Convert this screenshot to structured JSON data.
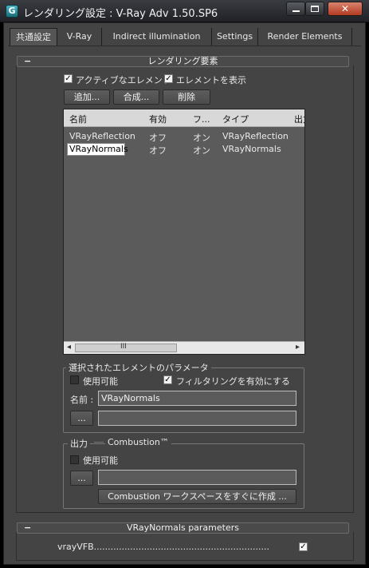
{
  "window": {
    "title": "レンダリング設定 : V-Ray Adv 1.50.SP6",
    "app_icon_glyph": "G",
    "app_icon_name": "3dsmax-icon",
    "close_glyph": "✕"
  },
  "tabs": [
    {
      "label": "共通設定",
      "active": true
    },
    {
      "label": "V-Ray"
    },
    {
      "label": "Indirect illumination"
    },
    {
      "label": "Settings"
    },
    {
      "label": "Render Elements"
    }
  ],
  "elements_rollout": {
    "toggle": "−",
    "title": "レンダリング要素",
    "active_elements_label": "アクティブなエレメント",
    "active_elements_checked": true,
    "display_elements_label": "エレメントを表示",
    "display_elements_checked": true,
    "add_button": "追加...",
    "merge_button": "合成...",
    "delete_button": "削除",
    "columns": [
      "名前",
      "有効",
      "フ...",
      "タイプ",
      "出力"
    ],
    "rows": [
      {
        "name": "VRayReflection",
        "enabled": "オフ",
        "filter": "オン",
        "type": "VRayReflection",
        "selected": false
      },
      {
        "name": "VRayNormals",
        "enabled": "オフ",
        "filter": "オン",
        "type": "VRayNormals",
        "selected": true
      }
    ],
    "scroll_left": "◂",
    "scroll_right": "▸",
    "scroll_grip": "III"
  },
  "selected_params": {
    "group_label": "選択されたエレメントのパラメータ",
    "enable_label": "使用可能",
    "enable_checked": false,
    "filter_label": "フィルタリングを有効にする",
    "filter_checked": true,
    "name_label": "名前 :",
    "name_value": "VRayNormals",
    "browse_button": "...",
    "path_value": ""
  },
  "output": {
    "group_label": "出力",
    "combustion_label": "Combustion™",
    "enable_label": "使用可能",
    "enable_checked": false,
    "browse_button": "...",
    "path_value": "",
    "create_workspace_button": "Combustion ワークスペースをすぐに作成 ..."
  },
  "normals_rollout": {
    "toggle": "−",
    "title": "VRayNormals parameters",
    "vrayvfb_label": "vrayVFB...............................................................",
    "vrayvfb_checked": true
  }
}
